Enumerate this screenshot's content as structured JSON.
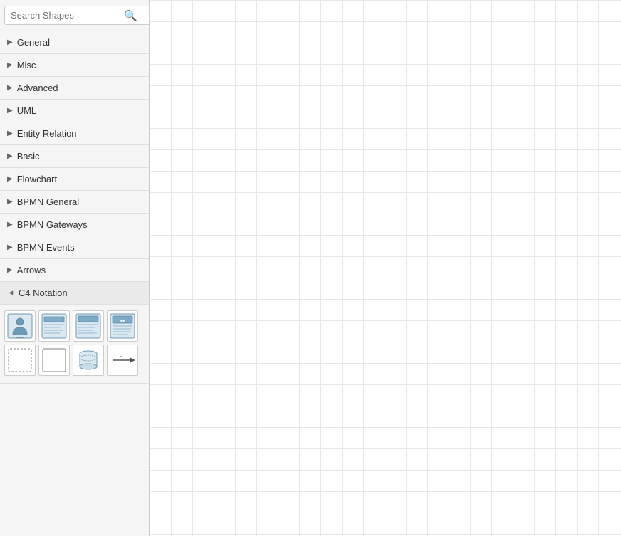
{
  "sidebar": {
    "search": {
      "placeholder": "Search Shapes",
      "value": ""
    },
    "nav_items": [
      {
        "id": "general",
        "label": "General",
        "expanded": false
      },
      {
        "id": "misc",
        "label": "Misc",
        "expanded": false
      },
      {
        "id": "advanced",
        "label": "Advanced",
        "expanded": false
      },
      {
        "id": "uml",
        "label": "UML",
        "expanded": false
      },
      {
        "id": "entity-relation",
        "label": "Entity Relation",
        "expanded": false
      },
      {
        "id": "basic",
        "label": "Basic",
        "expanded": false
      },
      {
        "id": "flowchart",
        "label": "Flowchart",
        "expanded": false
      },
      {
        "id": "bpmn-general",
        "label": "BPMN General",
        "expanded": false
      },
      {
        "id": "bpmn-gateways",
        "label": "BPMN Gateways",
        "expanded": false
      },
      {
        "id": "bpmn-events",
        "label": "BPMN Events",
        "expanded": false
      },
      {
        "id": "arrows",
        "label": "Arrows",
        "expanded": false
      },
      {
        "id": "c4-notation",
        "label": "C4 Notation",
        "expanded": true
      }
    ]
  },
  "icons": {
    "search": "🔍",
    "arrow_right": "▶",
    "arrow_down": "▼"
  }
}
